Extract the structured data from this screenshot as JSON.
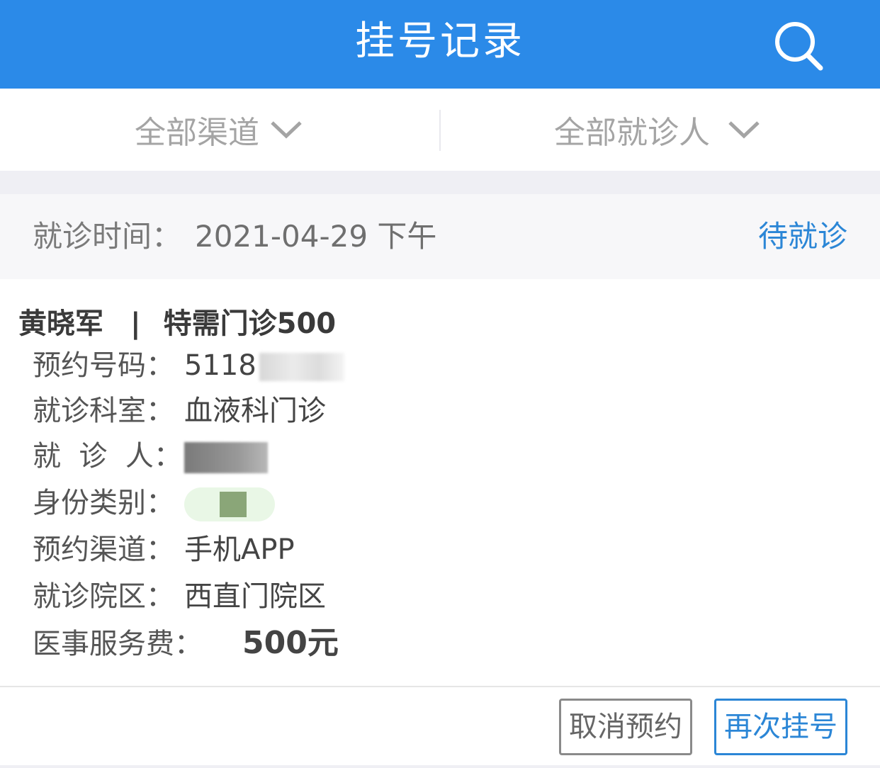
{
  "header": {
    "title": "挂号记录",
    "search_icon": "search-icon",
    "background_color": "#2b8ae8"
  },
  "filters": {
    "channel_label": "全部渠道",
    "patient_label": "全部就诊人"
  },
  "record": {
    "time_label": "就诊时间：",
    "time_value": "2021-04-29 下午",
    "status": "待就诊",
    "status_color": "#2b86d6",
    "doctor": "黄晓军",
    "separator": "|",
    "clinic_type": "特需门诊500",
    "fields": [
      {
        "label": "预约号码：",
        "value": "5118"
      },
      {
        "label": "就诊科室：",
        "value": "血液科门诊"
      },
      {
        "label": "就  诊  人：",
        "value": ""
      },
      {
        "label": "身份类别：",
        "value": ""
      },
      {
        "label": "预约渠道：",
        "value": "手机APP"
      },
      {
        "label": "就诊院区：",
        "value": "西直门院区"
      }
    ],
    "fee_label": "医事服务费：",
    "fee_value": "500元"
  },
  "actions": {
    "cancel_label": "取消预约",
    "again_label": "再次挂号"
  }
}
